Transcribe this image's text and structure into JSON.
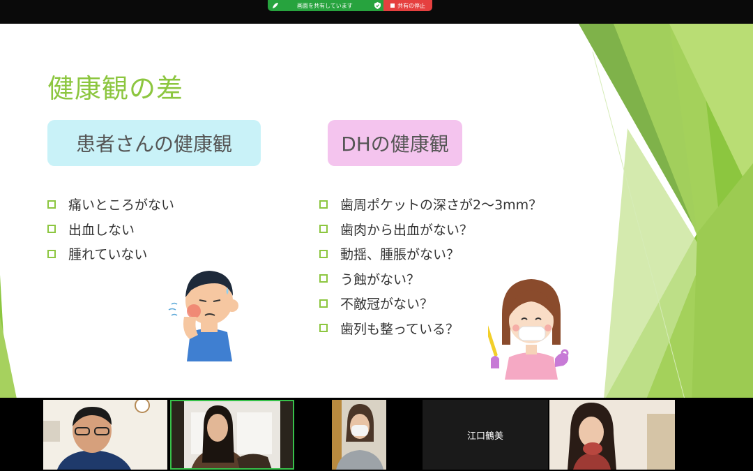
{
  "share_bar": {
    "sharing_label": "画面を共有しています",
    "stop_label": "共有の停止"
  },
  "slide": {
    "title": "健康観の差",
    "patient_heading": "患者さんの健康観",
    "dh_heading": "DHの健康観",
    "patient_items": [
      "痛いところがない",
      "出血しない",
      "腫れていない"
    ],
    "dh_items": [
      "歯周ポケットの深さが2〜3mm？",
      "歯肉から出血がない？",
      "動揺、腫脹がない？",
      "う蝕がない？",
      "不敵冠がない？",
      "歯列も整っている？"
    ]
  },
  "participants": {
    "name_only": "江口鶴美"
  },
  "colors": {
    "accent_green": "#8cc63f",
    "pill_cyan": "#c9f2f8",
    "pill_pink": "#f4c4ee",
    "share_green": "#27a33e",
    "stop_red": "#e5403f"
  }
}
